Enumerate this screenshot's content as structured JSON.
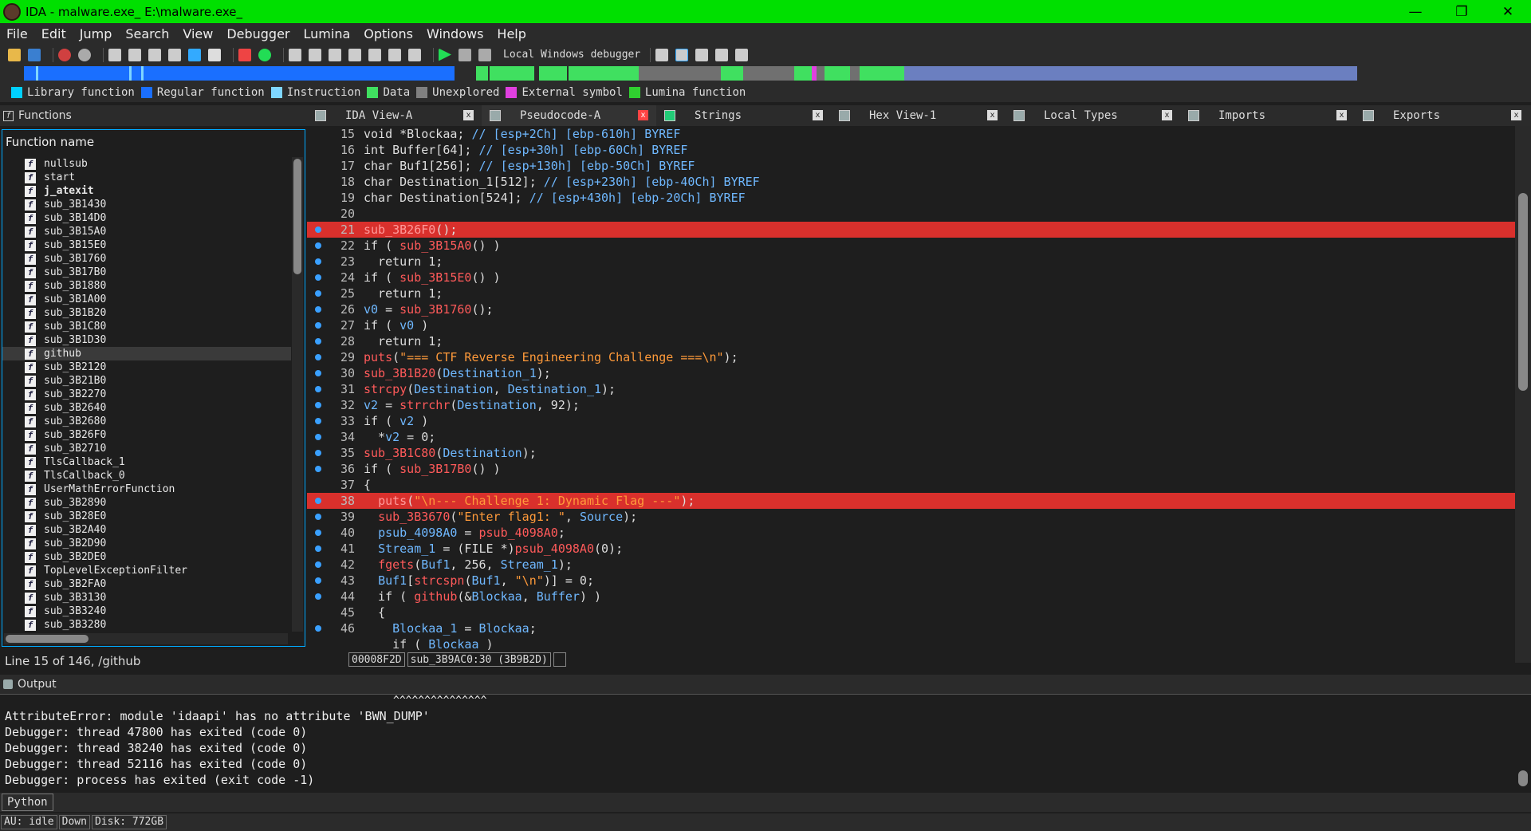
{
  "window": {
    "title": "IDA - malware.exe_ E:\\malware.exe_",
    "minimize": "—",
    "restore": "❐",
    "close": "✕"
  },
  "menu": [
    "File",
    "Edit",
    "Jump",
    "Search",
    "View",
    "Debugger",
    "Lumina",
    "Options",
    "Windows",
    "Help"
  ],
  "toolbar": {
    "debugger_label": "Local Windows debugger"
  },
  "legend": [
    {
      "label": "Library function",
      "color": "#00d0ff"
    },
    {
      "label": "Regular function",
      "color": "#1a6fff"
    },
    {
      "label": "Instruction",
      "color": "#7fd6ff"
    },
    {
      "label": "Data",
      "color": "#40e060"
    },
    {
      "label": "Unexplored",
      "color": "#808080"
    },
    {
      "label": "External symbol",
      "color": "#e040e0"
    },
    {
      "label": "Lumina function",
      "color": "#30d030"
    }
  ],
  "tabs": [
    {
      "label": "IDA View-A",
      "active": false
    },
    {
      "label": "Pseudocode-A",
      "active": true
    },
    {
      "label": "Strings",
      "active": false
    },
    {
      "label": "Hex View-1",
      "active": false
    },
    {
      "label": "Local Types",
      "active": false
    },
    {
      "label": "Imports",
      "active": false
    },
    {
      "label": "Exports",
      "active": false
    }
  ],
  "functions": {
    "panel_title": "Functions",
    "column_header": "Function name",
    "items": [
      "nullsub",
      "start",
      "j_atexit",
      "sub_3B1430",
      "sub_3B14D0",
      "sub_3B15A0",
      "sub_3B15E0",
      "sub_3B1760",
      "sub_3B17B0",
      "sub_3B1880",
      "sub_3B1A00",
      "sub_3B1B20",
      "sub_3B1C80",
      "sub_3B1D30",
      "github",
      "sub_3B2120",
      "sub_3B21B0",
      "sub_3B2270",
      "sub_3B2640",
      "sub_3B2680",
      "sub_3B26F0",
      "sub_3B2710",
      "TlsCallback_1",
      "TlsCallback_0",
      "UserMathErrorFunction",
      "sub_3B2890",
      "sub_3B28E0",
      "sub_3B2A40",
      "sub_3B2D90",
      "sub_3B2DE0",
      "TopLevelExceptionFilter",
      "sub_3B2FA0",
      "sub_3B3130",
      "sub_3B3240",
      "sub_3B3280"
    ],
    "status": "Line 15 of 146, /github"
  },
  "code": [
    {
      "n": "15",
      "dot": false,
      "hl": false,
      "html": "void *Blockaa; <span class='vr'>// [esp+2Ch] [ebp-610h] BYREF</span>"
    },
    {
      "n": "16",
      "dot": false,
      "hl": false,
      "html": "int Buffer[64]; <span class='vr'>// [esp+30h] [ebp-60Ch] BYREF</span>"
    },
    {
      "n": "17",
      "dot": false,
      "hl": false,
      "html": "char Buf1[256]; <span class='vr'>// [esp+130h] [ebp-50Ch] BYREF</span>"
    },
    {
      "n": "18",
      "dot": false,
      "hl": false,
      "html": "char Destination_1[512]; <span class='vr'>// [esp+230h] [ebp-40Ch] BYREF</span>"
    },
    {
      "n": "19",
      "dot": false,
      "hl": false,
      "html": "char Destination[524]; <span class='vr'>// [esp+430h] [ebp-20Ch] BYREF</span>"
    },
    {
      "n": "20",
      "dot": false,
      "hl": false,
      "html": ""
    },
    {
      "n": "21",
      "dot": true,
      "hl": true,
      "html": "<span class='fn'>sub_3B26F0</span>();"
    },
    {
      "n": "22",
      "dot": true,
      "hl": false,
      "html": "if ( <span class='fn'>sub_3B15A0</span>() )"
    },
    {
      "n": "23",
      "dot": true,
      "hl": false,
      "html": "  return 1;"
    },
    {
      "n": "24",
      "dot": true,
      "hl": false,
      "html": "if ( <span class='fn'>sub_3B15E0</span>() )"
    },
    {
      "n": "25",
      "dot": true,
      "hl": false,
      "html": "  return 1;"
    },
    {
      "n": "26",
      "dot": true,
      "hl": false,
      "html": "<span class='vr'>v0</span> = <span class='fn'>sub_3B1760</span>();"
    },
    {
      "n": "27",
      "dot": true,
      "hl": false,
      "html": "if ( <span class='vr'>v0</span> )"
    },
    {
      "n": "28",
      "dot": true,
      "hl": false,
      "html": "  return 1;"
    },
    {
      "n": "29",
      "dot": true,
      "hl": false,
      "html": "<span class='fn'>puts</span>(<span class='str'>\"=== CTF Reverse Engineering Challenge ===\\n\"</span>);"
    },
    {
      "n": "30",
      "dot": true,
      "hl": false,
      "html": "<span class='fn'>sub_3B1B20</span>(<span class='vr'>Destination_1</span>);"
    },
    {
      "n": "31",
      "dot": true,
      "hl": false,
      "html": "<span class='fn'>strcpy</span>(<span class='vr'>Destination</span>, <span class='vr'>Destination_1</span>);"
    },
    {
      "n": "32",
      "dot": true,
      "hl": false,
      "html": "<span class='vr'>v2</span> = <span class='fn'>strrchr</span>(<span class='vr'>Destination</span>, 92);"
    },
    {
      "n": "33",
      "dot": true,
      "hl": false,
      "html": "if ( <span class='vr'>v2</span> )"
    },
    {
      "n": "34",
      "dot": true,
      "hl": false,
      "html": "  *<span class='vr'>v2</span> = 0;"
    },
    {
      "n": "35",
      "dot": true,
      "hl": false,
      "html": "<span class='fn'>sub_3B1C80</span>(<span class='vr'>Destination</span>);"
    },
    {
      "n": "36",
      "dot": true,
      "hl": false,
      "html": "if ( <span class='fn'>sub_3B17B0</span>() )"
    },
    {
      "n": "37",
      "dot": false,
      "hl": false,
      "html": "{"
    },
    {
      "n": "38",
      "dot": true,
      "hl": true,
      "html": "  <span class='fn'>puts</span>(<span class='str'>\"\\n--- Challenge 1: Dynamic Flag ---\"</span>);"
    },
    {
      "n": "39",
      "dot": true,
      "hl": false,
      "html": "  <span class='fn'>sub_3B3670</span>(<span class='str'>\"Enter flag1: \"</span>, <span class='vr'>Source</span>);"
    },
    {
      "n": "40",
      "dot": true,
      "hl": false,
      "html": "  <span class='vr'>psub_4098A0</span> = <span class='fn'>psub_4098A0</span>;"
    },
    {
      "n": "41",
      "dot": true,
      "hl": false,
      "html": "  <span class='vr'>Stream_1</span> = (FILE *)<span class='fn'>psub_4098A0</span>(0);"
    },
    {
      "n": "42",
      "dot": true,
      "hl": false,
      "html": "  <span class='fn'>fgets</span>(<span class='vr'>Buf1</span>, 256, <span class='vr'>Stream_1</span>);"
    },
    {
      "n": "43",
      "dot": true,
      "hl": false,
      "html": "  <span class='vr'>Buf1</span>[<span class='fn'>strcspn</span>(<span class='vr'>Buf1</span>, <span class='str'>\"\\n\"</span>)] = 0;"
    },
    {
      "n": "44",
      "dot": true,
      "hl": false,
      "html": "  if ( <span class='fn'>github</span>(&amp;<span class='vr'>Blockaa</span>, <span class='vr'>Buffer</span>) )"
    },
    {
      "n": "45",
      "dot": false,
      "hl": false,
      "html": "  {"
    },
    {
      "n": "46",
      "dot": true,
      "hl": false,
      "html": "    <span class='vr'>Blockaa_1</span> = <span class='vr'>Blockaa</span>;"
    },
    {
      "n": "",
      "dot": false,
      "hl": false,
      "html": "    if ( <span class='vr'>Blockaa</span> )"
    }
  ],
  "code_status": {
    "addr": "00008F2D",
    "func": "sub_3B9AC0:30 (3B9B2D)"
  },
  "output": {
    "title": "Output",
    "carets": "^^^^^^^^^^^^^^^",
    "lines": [
      "AttributeError: module 'idaapi' has no attribute 'BWN_DUMP'",
      "Debugger: thread 47800 has exited (code 0)",
      "Debugger: thread 38240 has exited (code 0)",
      "Debugger: thread 52116 has exited (code 0)",
      "Debugger: process has exited (exit code -1)"
    ]
  },
  "python_label": "Python",
  "status": {
    "au": "AU:  idle",
    "dir": "Down",
    "disk": "Disk: 772GB"
  }
}
